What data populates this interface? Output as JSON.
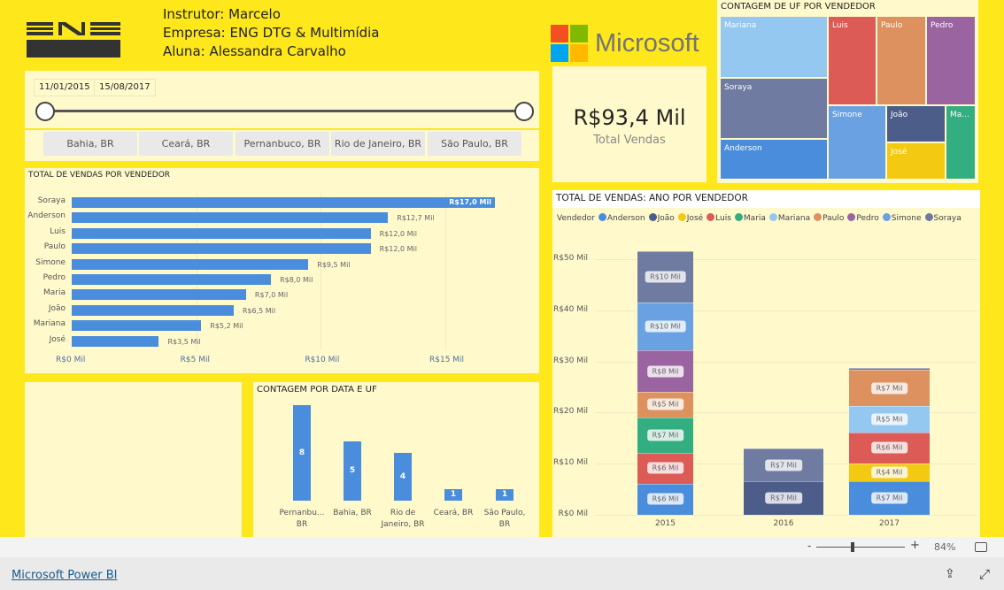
{
  "header": {
    "lines": [
      "Instrutor: Marcelo",
      "Empresa: ENG DTG & Multimídia",
      "Aluna: Alessandra Carvalho"
    ],
    "logo_text": "ENG"
  },
  "date_slicer": {
    "start": "11/01/2015",
    "end": "15/08/2017",
    "range_fraction": [
      0,
      1
    ]
  },
  "uf_slicer": [
    "Bahia, BR",
    "Ceará, BR",
    "Pernanbuco, BR",
    "Rio de Janeiro, BR",
    "São Paulo, BR"
  ],
  "microsoft": {
    "text": "Microsoft",
    "colors": [
      "#f25022",
      "#7fba00",
      "#00a4ef",
      "#ffb900"
    ]
  },
  "kpi": {
    "value": "R$93,4 Mil",
    "label": "Total Vendas"
  },
  "colors": {
    "background": "#fee71a",
    "panel": "#fff9cc",
    "Anderson": "#4a8ddc",
    "João": "#4c5d8a",
    "José": "#f3c911",
    "Luis": "#dc5b57",
    "Maria": "#33ae81",
    "Mariana": "#95c8f0",
    "Paulo": "#dd915f",
    "Pedro": "#9a64a0",
    "Simone": "#6aa1e2",
    "Soraya": "#6f7ba0"
  },
  "chart_data": [
    {
      "type": "bar",
      "orientation": "horizontal",
      "title": "TOTAL DE VENDAS POR VENDEDOR",
      "categories": [
        "Soraya",
        "Anderson",
        "Luis",
        "Paulo",
        "Simone",
        "Pedro",
        "Maria",
        "João",
        "Mariana",
        "José"
      ],
      "values": [
        17.0,
        12.7,
        12.0,
        12.0,
        9.5,
        8.0,
        7.0,
        6.5,
        5.2,
        3.5
      ],
      "data_labels": [
        "R$17,0 Mil",
        "R$12,7 Mil",
        "R$12,0 Mil",
        "R$12,0 Mil",
        "R$9,5 Mil",
        "R$8,0 Mil",
        "R$7,0 Mil",
        "R$6,5 Mil",
        "R$5,2 Mil",
        "R$3,5 Mil"
      ],
      "xticks": [
        "R$0 Mil",
        "R$5 Mil",
        "R$10 Mil",
        "R$15 Mil"
      ],
      "xlim": [
        0,
        15.5
      ]
    },
    {
      "type": "bar",
      "title": "CONTAGEM POR DATA E UF",
      "categories": [
        "Pernanbu... BR",
        "Bahia, BR",
        "Rio de Janeiro, BR",
        "Ceará, BR",
        "São Paulo, BR"
      ],
      "values": [
        8,
        5,
        4,
        1,
        1
      ]
    },
    {
      "type": "treemap",
      "title": "CONTAGEM DE UF POR VENDEDOR",
      "items": [
        "Mariana",
        "Soraya",
        "Anderson",
        "Luis",
        "Paulo",
        "Pedro",
        "Simone",
        "João",
        "José",
        "Ma..."
      ]
    },
    {
      "type": "stacked-bar",
      "title": "TOTAL DE VENDAS: ANO POR VENDEDOR",
      "legend_title": "Vendedor",
      "legend": [
        "Anderson",
        "João",
        "José",
        "Luis",
        "Maria",
        "Mariana",
        "Paulo",
        "Pedro",
        "Simone",
        "Soraya"
      ],
      "categories": [
        "2015",
        "2016",
        "2017"
      ],
      "yticks": [
        "R$0 Mil",
        "R$10 Mil",
        "R$20 Mil",
        "R$30 Mil",
        "R$40 Mil",
        "R$50 Mil"
      ],
      "ylim": [
        0,
        50
      ],
      "stacks": [
        [
          {
            "name": "Anderson",
            "value": 6.1,
            "label": "R$6 Mil"
          },
          {
            "name": "Luis",
            "value": 6,
            "label": "R$6 Mil"
          },
          {
            "name": "Maria",
            "value": 7,
            "label": "R$7 Mil"
          },
          {
            "name": "Paulo",
            "value": 5,
            "label": "R$5 Mil"
          },
          {
            "name": "Pedro",
            "value": 8,
            "label": "R$8 Mil"
          },
          {
            "name": "Simone",
            "value": 9.5,
            "label": "R$10 Mil"
          },
          {
            "name": "Soraya",
            "value": 10,
            "label": "R$10 Mil"
          }
        ],
        [
          {
            "name": "João",
            "value": 6.5,
            "label": "R$7 Mil"
          },
          {
            "name": "Soraya",
            "value": 6.5,
            "label": "R$7 Mil"
          }
        ],
        [
          {
            "name": "Anderson",
            "value": 6.6,
            "label": "R$7 Mil"
          },
          {
            "name": "José",
            "value": 3.5,
            "label": "R$4 Mil"
          },
          {
            "name": "Luis",
            "value": 6,
            "label": "R$6 Mil"
          },
          {
            "name": "Mariana",
            "value": 5.2,
            "label": "R$5 Mil"
          },
          {
            "name": "Paulo",
            "value": 7,
            "label": "R$7 Mil"
          },
          {
            "name": "Soraya",
            "value": 0.5,
            "label": ""
          }
        ]
      ]
    }
  ],
  "footer": {
    "zoom_minus": "-",
    "zoom_plus": "+",
    "zoom_level": "84%",
    "zoom_fraction": 0.42,
    "link": "Microsoft Power BI"
  }
}
